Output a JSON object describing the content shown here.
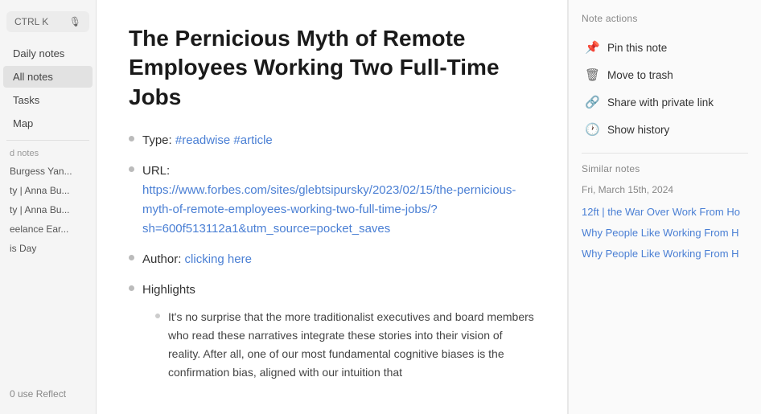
{
  "sidebar": {
    "search": {
      "shortcut": "CTRL K"
    },
    "nav_items": [
      {
        "label": "Daily notes",
        "active": false
      },
      {
        "label": "All notes",
        "active": true
      },
      {
        "label": "Tasks",
        "active": false
      },
      {
        "label": "Map",
        "active": false
      }
    ],
    "section_label": "d notes",
    "recent_notes": [
      {
        "label": "Burgess Yan..."
      },
      {
        "label": "ty | Anna Bu..."
      },
      {
        "label": "ty | Anna Bu..."
      },
      {
        "label": "eelance Ear..."
      },
      {
        "label": "is Day"
      }
    ],
    "footer": "0 use Reflect"
  },
  "article": {
    "title": "The Pernicious Myth of Remote Employees Working Two Full-Time Jobs",
    "type_label": "Type:",
    "type_tags": "#readwise #article",
    "url_label": "URL:",
    "url_text": "https://www.forbes.com/sites/glebtsipursky/2023/02/15/the-pernicious-myth-of-remote-employees-working-two-full-time-jobs/?sh=600f513112a1&utm_source=pocket_saves",
    "author_label": "Author:",
    "author_link": "clicking here",
    "highlights_label": "Highlights",
    "highlight_text": "It's no surprise that the more traditionalist executives and board members who read these narratives integrate these stories into their vision of reality. After all, one of our most fundamental cognitive biases is the confirmation bias, aligned with our intuition that"
  },
  "right_panel": {
    "note_actions_title": "Note actions",
    "actions": [
      {
        "label": "Pin this note",
        "icon": "📌"
      },
      {
        "label": "Move to trash",
        "icon": "🗑"
      },
      {
        "label": "Share with private link",
        "icon": "🔗"
      },
      {
        "label": "Show history",
        "icon": "🕐"
      }
    ],
    "similar_notes_title": "Similar notes",
    "similar_date": "Fri, March 15th, 2024",
    "similar_items": [
      {
        "label": "12ft | the War Over Work From Ho"
      },
      {
        "label": "Why People Like Working From H"
      },
      {
        "label": "Why People Like Working From H"
      }
    ]
  }
}
